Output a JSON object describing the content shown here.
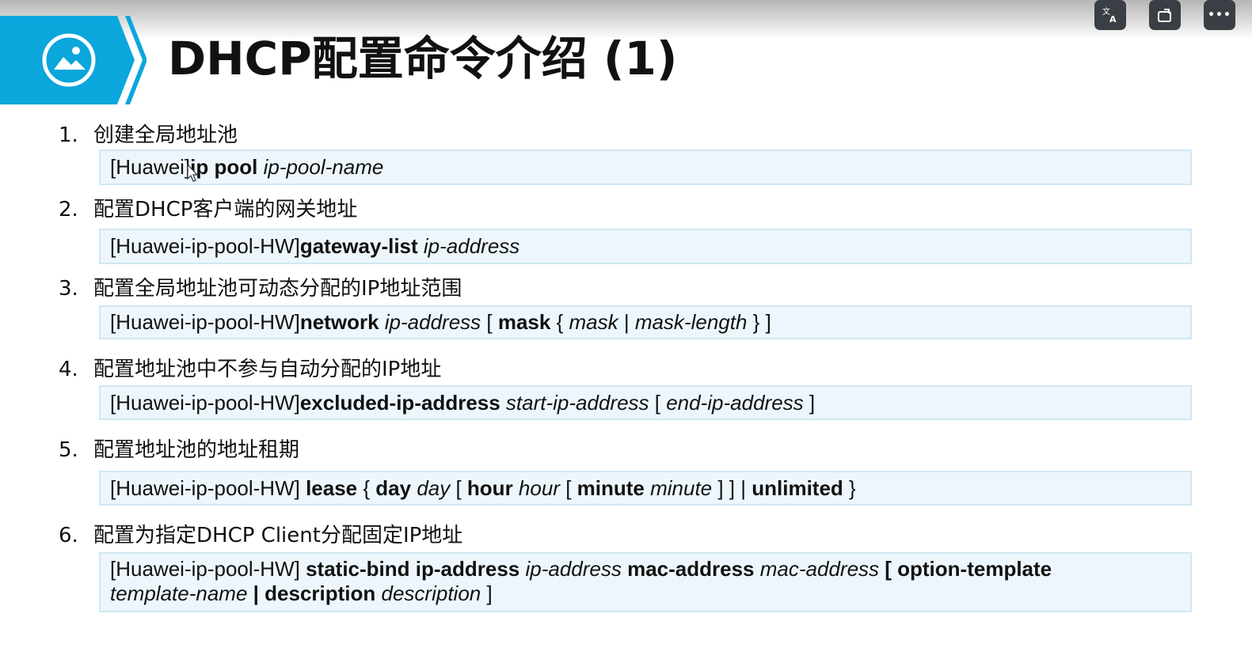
{
  "title": "DHCP配置命令介绍 (1)",
  "toolbar": {
    "buttons": [
      {
        "icon": "translate-icon"
      },
      {
        "icon": "window-rotate-icon"
      },
      {
        "icon": "more-icon",
        "label": "•••"
      }
    ]
  },
  "banner": {
    "icon": "image-icon",
    "color": "#0aa6dc"
  },
  "items": [
    {
      "num": "1.",
      "label": "创建全局地址池",
      "cmd": [
        {
          "t": "[Huawei]",
          "s": "n"
        },
        {
          "t": "ip pool ",
          "s": "b"
        },
        {
          "t": "ip-pool-name",
          "s": "i"
        }
      ]
    },
    {
      "num": "2.",
      "label": "配置DHCP客户端的网关地址",
      "cmd": [
        {
          "t": "[Huawei-ip-pool-HW]",
          "s": "n"
        },
        {
          "t": "gateway-list ",
          "s": "b"
        },
        {
          "t": "ip-address",
          "s": "i"
        }
      ]
    },
    {
      "num": "3.",
      "label": "配置全局地址池可动态分配的IP地址范围",
      "cmd": [
        {
          "t": "[Huawei-ip-pool-HW]",
          "s": "n"
        },
        {
          "t": "network ",
          "s": "b"
        },
        {
          "t": "ip-address",
          "s": "i"
        },
        {
          "t": " [ ",
          "s": "n"
        },
        {
          "t": "mask",
          "s": "b"
        },
        {
          "t": " { ",
          "s": "n"
        },
        {
          "t": "mask",
          "s": "i"
        },
        {
          "t": " | ",
          "s": "n"
        },
        {
          "t": "mask-length",
          "s": "i"
        },
        {
          "t": " } ]",
          "s": "n"
        }
      ]
    },
    {
      "num": "4.",
      "label": "配置地址池中不参与自动分配的IP地址",
      "cmd": [
        {
          "t": "[Huawei-ip-pool-HW]",
          "s": "n"
        },
        {
          "t": "excluded-ip-address ",
          "s": "b"
        },
        {
          "t": "start-ip-address",
          "s": "i"
        },
        {
          "t": " [ ",
          "s": "n"
        },
        {
          "t": "end-ip-address",
          "s": "i"
        },
        {
          "t": " ]",
          "s": "n"
        }
      ]
    },
    {
      "num": "5.",
      "label": "配置地址池的地址租期",
      "cmd": [
        {
          "t": "[Huawei-ip-pool-HW] ",
          "s": "n"
        },
        {
          "t": "lease",
          "s": "b"
        },
        {
          "t": " { ",
          "s": "n"
        },
        {
          "t": "day ",
          "s": "b"
        },
        {
          "t": "day",
          "s": "i"
        },
        {
          "t": " [ ",
          "s": "n"
        },
        {
          "t": "hour ",
          "s": "b"
        },
        {
          "t": "hour",
          "s": "i"
        },
        {
          "t": " [ ",
          "s": "n"
        },
        {
          "t": "minute ",
          "s": "b"
        },
        {
          "t": "minute",
          "s": "i"
        },
        {
          "t": " ] ] | ",
          "s": "n"
        },
        {
          "t": "unlimited",
          "s": "b"
        },
        {
          "t": " }",
          "s": "n"
        }
      ]
    },
    {
      "num": "6.",
      "label": "配置为指定DHCP Client分配固定IP地址",
      "cmd": [
        {
          "t": "[Huawei-ip-pool-HW] ",
          "s": "n"
        },
        {
          "t": "static-bind ip-address ",
          "s": "b"
        },
        {
          "t": "ip-address",
          "s": "i"
        },
        {
          "t": " mac-address ",
          "s": "b"
        },
        {
          "t": "mac-address",
          "s": "i"
        },
        {
          "t": " [ option-template",
          "s": "b"
        },
        {
          "t": "BR",
          "s": "br"
        },
        {
          "t": "template-name",
          "s": "i"
        },
        {
          "t": " | ",
          "s": "b"
        },
        {
          "t": "description ",
          "s": "b"
        },
        {
          "t": "description",
          "s": "i"
        },
        {
          "t": " ]",
          "s": "n"
        }
      ]
    }
  ]
}
